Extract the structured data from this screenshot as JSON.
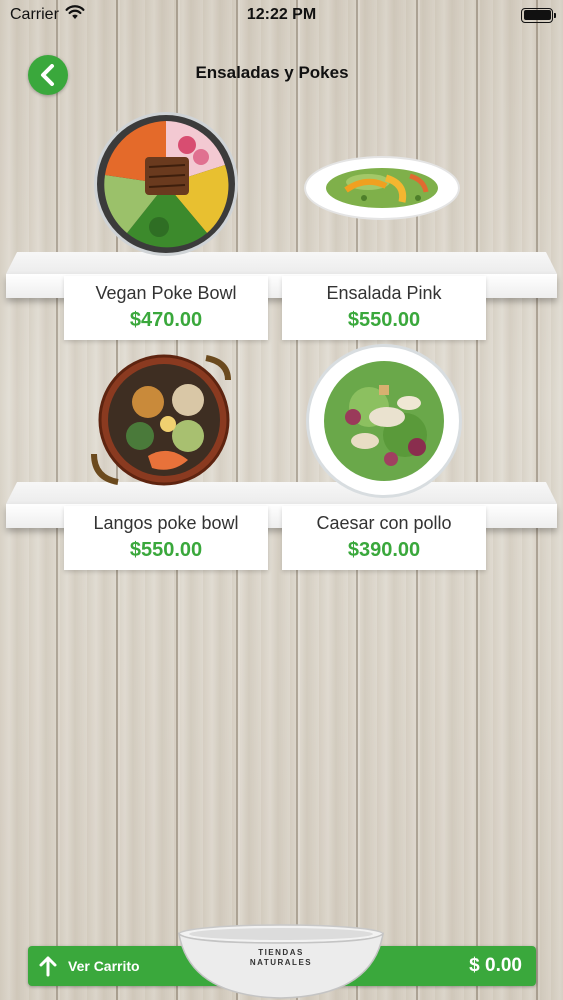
{
  "status_bar": {
    "carrier": "Carrier",
    "time": "12:22 PM",
    "wifi_icon": "wifi-icon",
    "battery_icon": "battery-icon"
  },
  "header": {
    "title": "Ensaladas y Pokes",
    "back_icon": "chevron-left-icon",
    "accent_color": "#3aa83c"
  },
  "products": [
    {
      "name": "Vegan Poke Bowl",
      "price": "$470.00",
      "image": "poke-bowl-image"
    },
    {
      "name": "Ensalada Pink",
      "price": "$550.00",
      "image": "salad-plate-image"
    },
    {
      "name": "Langos poke bowl",
      "price": "$550.00",
      "image": "shrimp-bowl-image"
    },
    {
      "name": "Caesar con pollo",
      "price": "$390.00",
      "image": "caesar-salad-image"
    }
  ],
  "cart": {
    "label": "Ver Carrito",
    "total": "$ 0.00",
    "arrow_icon": "arrow-up-icon",
    "bowl_brand_line1": "TIENDAS",
    "bowl_brand_line2": "NATURALES"
  }
}
